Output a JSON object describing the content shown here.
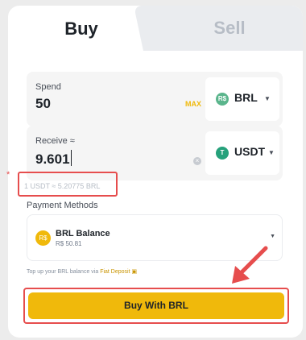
{
  "tabs": {
    "buy_label": "Buy",
    "sell_label": "Sell"
  },
  "spend": {
    "label": "Spend",
    "value": "50",
    "max_label": "MAX",
    "currency": {
      "code": "BRL",
      "badge": "R$",
      "color": "#5ab58c"
    }
  },
  "receive": {
    "label": "Receive ≈",
    "value": "9.601",
    "clear_icon": "×",
    "currency": {
      "code": "USDT",
      "badge": "T",
      "color": "#26a17b"
    }
  },
  "rate_text": "1 USDT ≈ 5.20775 BRL",
  "rate_marker": "*",
  "payment": {
    "label": "Payment Methods",
    "method_name": "BRL Balance",
    "method_balance": "R$  50.81",
    "icon_glyph": "R$"
  },
  "topup": {
    "text": "Top up your BRL balance via ",
    "link": "Fiat Deposit",
    "link_icon": "▣"
  },
  "buy_button_label": "Buy With BRL",
  "colors": {
    "accent": "#f0b90b",
    "highlight": "#e64d4d"
  }
}
